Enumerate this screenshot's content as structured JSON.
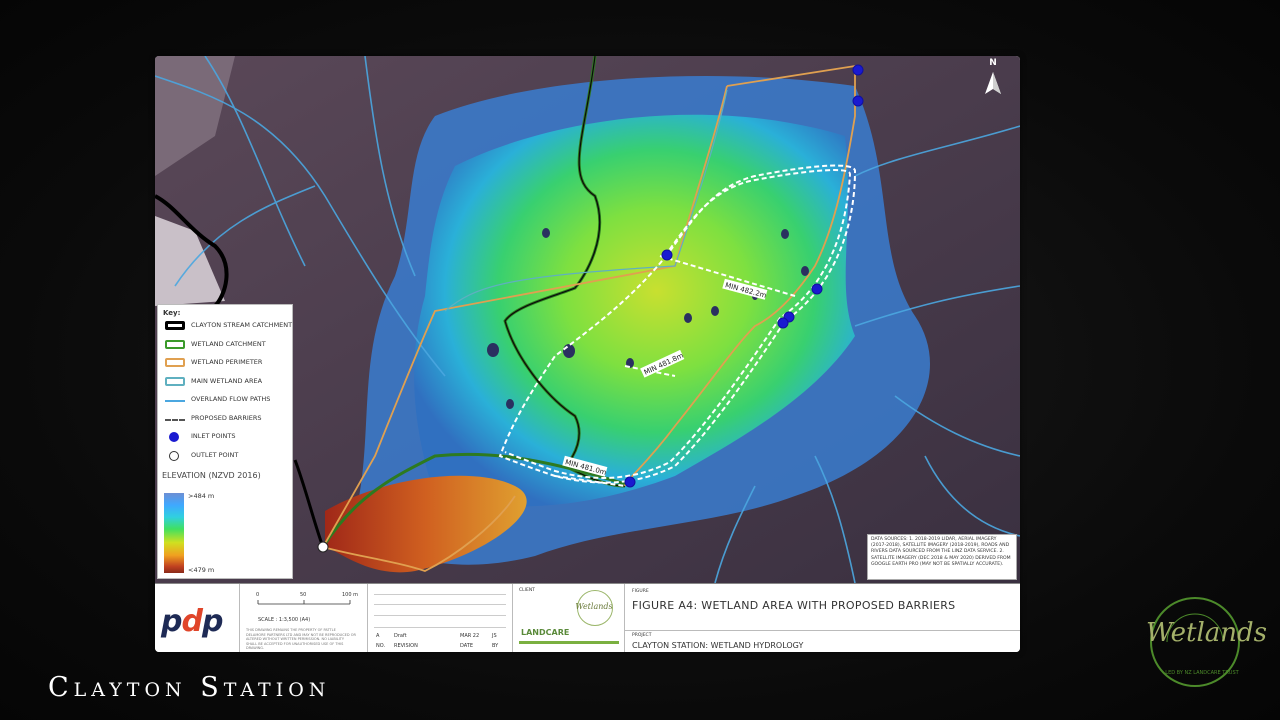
{
  "slide_title": "Clayton Station",
  "map": {
    "north": "N",
    "legend": {
      "title": "Key:",
      "items": [
        {
          "label": "CLAYTON STREAM CATCHMENT",
          "color": "#000000",
          "kind": "box-thick"
        },
        {
          "label": "WETLAND CATCHMENT",
          "color": "#3a9a2a",
          "kind": "box"
        },
        {
          "label": "WETLAND PERIMETER",
          "color": "#e0a050",
          "kind": "box"
        },
        {
          "label": "MAIN WETLAND AREA",
          "color": "#5fb0c0",
          "kind": "box"
        },
        {
          "label": "OVERLAND FLOW PATHS",
          "color": "#4ba7e0",
          "kind": "line"
        },
        {
          "label": "PROPOSED BARRIERS",
          "color": "#555555",
          "kind": "barrier"
        },
        {
          "label": "INLET POINTS",
          "color": "#1a1ad0",
          "kind": "dot"
        },
        {
          "label": "OUTLET POINT",
          "color": "#ffffff",
          "kind": "ring"
        }
      ],
      "elevation_title": "ELEVATION (NZVD 2016)",
      "elevation_max": ">484 m",
      "elevation_min": "<479 m"
    },
    "barrier_labels": [
      "MIN 482.2m",
      "MIN 481.8m",
      "MIN 481.0m"
    ],
    "data_sources": "DATA SOURCES: 1. 2018-2019 LIDAR, AERIAL IMAGERY (2017-2018), SATELLITE IMAGERY (2018-2019), ROADS AND RIVERS DATA SOURCED FROM THE LINZ DATA SERVICE. 2. SATELLITE IMAGERY (DEC 2018 & MAY 2020) DERIVED FROM GOOGLE EARTH PRO (MAY NOT BE SPATIALLY ACCURATE)."
  },
  "title_block": {
    "logo": "pdp",
    "scale_ticks": [
      "0",
      "50",
      "100 m"
    ],
    "scale_label": "SCALE : 1:3,500   (A4)",
    "disclaimer": "THIS DRAWING REMAINS THE PROPERTY OF PATTLE DELAMORE PARTNERS LTD AND MAY NOT BE REPRODUCED OR ALTERED WITHOUT WRITTEN PERMISSION. NO LIABILITY SHALL BE ACCEPTED FOR UNAUTHORISED USE OF THIS DRAWING.",
    "revision": {
      "no": "A",
      "desc": "Draft",
      "date": "MAR 22",
      "by": "JS"
    },
    "revision_headers": {
      "no": "NO.",
      "revision": "REVISION",
      "date": "DATE",
      "by": "BY"
    },
    "client_label": "CLIENT",
    "client_logo": "Wetlands",
    "landcare": "LANDCARE",
    "figure_label": "FIGURE",
    "figure_title": "FIGURE A4: WETLAND AREA WITH PROPOSED BARRIERS",
    "project_label": "PROJECT",
    "project_title": "CLAYTON STATION: WETLAND HYDROLOGY"
  },
  "brand_logo": {
    "word": "Wetlands",
    "subtitle": "LED BY NZ LANDCARE TRUST",
    "color": "#a4b06a"
  }
}
